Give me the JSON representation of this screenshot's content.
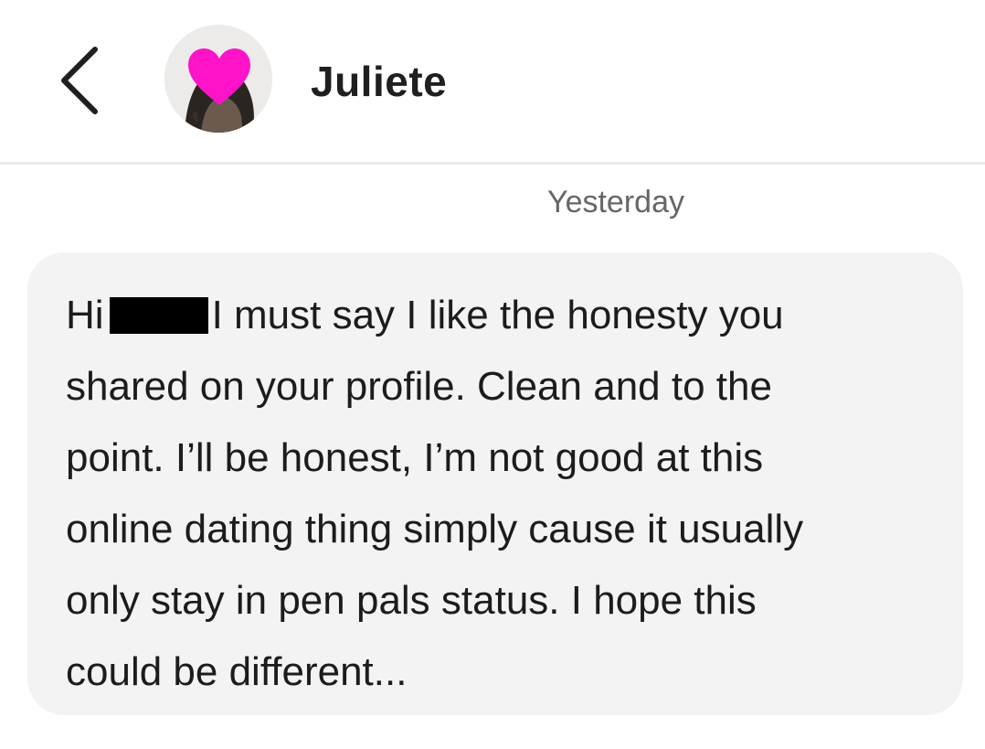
{
  "header": {
    "contact_name": "Juliete"
  },
  "icons": {
    "back": "chevron-left-icon",
    "heart_sticker": "heart-icon"
  },
  "colors": {
    "heart": "#ff13c9",
    "bubble_background": "#f3f3f3",
    "divider": "#ececec"
  },
  "conversation": {
    "date_separator": "Yesterday",
    "message": {
      "greeting": "Hi",
      "redacted_name": true,
      "line_1_rest": "I must say I like the honesty you",
      "line_2": "shared on your profile. Clean and to the",
      "line_3": "point. I’ll be honest, I’m not good at this",
      "line_4": "online dating thing simply cause it usually",
      "line_5": "only stay in pen pals status. I hope this",
      "line_6": "could be different..."
    }
  }
}
